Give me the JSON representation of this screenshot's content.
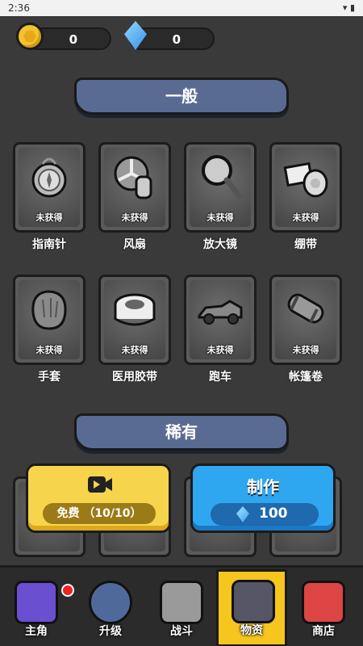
{
  "statusbar": {
    "time": "2:36",
    "icons": "▾ ▮"
  },
  "currencies": {
    "coins": "0",
    "gems": "0"
  },
  "sections": {
    "common": "一般",
    "rare": "稀有"
  },
  "common_items": [
    {
      "name": "指南针",
      "status": "未获得",
      "icon": "compass-icon"
    },
    {
      "name": "风扇",
      "status": "未获得",
      "icon": "fan-icon"
    },
    {
      "name": "放大镜",
      "status": "未获得",
      "icon": "magnifier-icon"
    },
    {
      "name": "绷带",
      "status": "未获得",
      "icon": "bandage-icon"
    },
    {
      "name": "手套",
      "status": "未获得",
      "icon": "glove-icon"
    },
    {
      "name": "医用胶带",
      "status": "未获得",
      "icon": "tape-icon"
    },
    {
      "name": "跑车",
      "status": "未获得",
      "icon": "sportscar-icon"
    },
    {
      "name": "帐篷卷",
      "status": "未获得",
      "icon": "tent-roll-icon"
    }
  ],
  "actions": {
    "free_label": "免费 （10/10）",
    "craft_label": "制作",
    "craft_cost": "100"
  },
  "nav": [
    {
      "label": "主角",
      "icon": "hero-icon"
    },
    {
      "label": "升级",
      "icon": "upgrade-icon"
    },
    {
      "label": "战斗",
      "icon": "battle-icon"
    },
    {
      "label": "物资",
      "icon": "supplies-icon"
    },
    {
      "label": "商店",
      "icon": "shop-icon"
    }
  ],
  "colors": {
    "accent_yellow": "#f6d54c",
    "accent_blue": "#2fa6f0",
    "banner": "#5a6b93"
  }
}
